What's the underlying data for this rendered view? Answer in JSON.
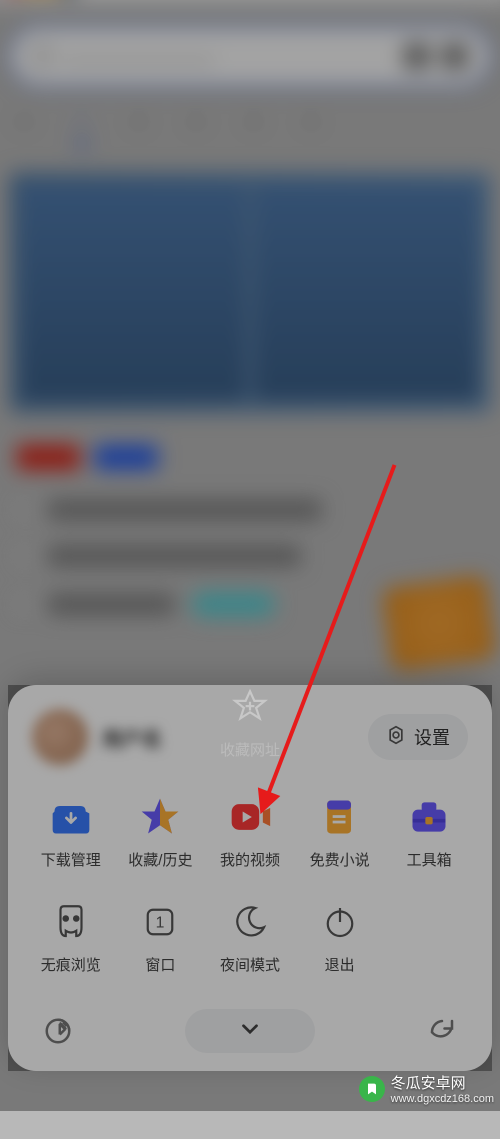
{
  "sheet": {
    "settings_label": "设置",
    "row1": [
      {
        "label": "下载管理",
        "icon": "download-icon"
      },
      {
        "label": "收藏/历史",
        "icon": "star-history-icon"
      },
      {
        "label": "我的视频",
        "icon": "video-icon"
      },
      {
        "label": "免费小说",
        "icon": "book-icon"
      },
      {
        "label": "工具箱",
        "icon": "toolbox-icon"
      }
    ],
    "row2": [
      {
        "label": "无痕浏览",
        "icon": "incognito-icon"
      },
      {
        "label": "收藏网址",
        "icon": "favorite-site-icon"
      },
      {
        "label": "窗口",
        "icon": "window-icon",
        "badge": "1"
      },
      {
        "label": "夜间模式",
        "icon": "night-icon"
      },
      {
        "label": "退出",
        "icon": "exit-icon"
      }
    ]
  },
  "watermark": {
    "text": "冬瓜安卓网",
    "url": "www.dgxcdz168.com"
  }
}
